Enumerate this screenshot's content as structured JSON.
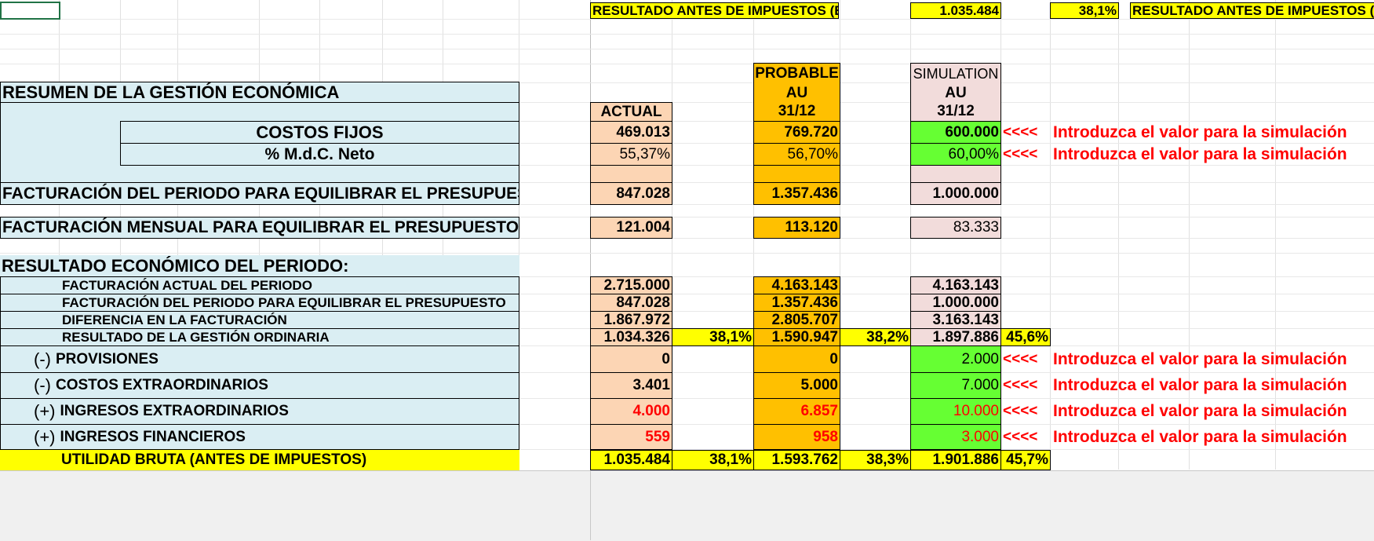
{
  "top": {
    "ebt_label": "RESULTADO ANTES DE IMPUESTOS (EBT)",
    "ebt_value": "1.035.484",
    "ebt_pct": "38,1%",
    "ebt_label2": "RESULTADO ANTES DE IMPUESTOS (EBT)"
  },
  "headers": {
    "probable": [
      "PROBABLE",
      "AU",
      "31/12"
    ],
    "simulation": [
      "SIMULATION",
      "AU",
      "31/12"
    ],
    "actual": "ACTUAL"
  },
  "summary": {
    "title": "RESUMEN DE LA GESTIÓN ECONÓMICA",
    "costos_fijos_label": "COSTOS FIJOS",
    "mdc_label": "% M.d.C. Neto",
    "fact_periodo_label": "FACTURACIÓN DEL PERIODO PARA EQUILIBRAR EL PRESUPUESTO",
    "fact_mensual_label": "FACTURACIÓN MENSUAL PARA EQUILIBRAR EL PRESUPUESTO"
  },
  "values": {
    "costos_fijos": [
      "469.013",
      "769.720",
      "600.000"
    ],
    "mdc": [
      "55,37%",
      "56,70%",
      "60,00%"
    ],
    "fact_periodo": [
      "847.028",
      "1.357.436",
      "1.000.000"
    ],
    "fact_mensual": [
      "121.004",
      "113.120",
      "83.333"
    ]
  },
  "hint": {
    "arrows": "<<<<",
    "text": "Introduzca el valor para la simulación"
  },
  "results": {
    "title": "RESULTADO ECONÓMICO DEL PERIODO:",
    "rows": [
      {
        "label": "FACTURACIÓN ACTUAL DEL PERIODO",
        "actual": "2.715.000",
        "probable": "4.163.143",
        "simulation": "4.163.143"
      },
      {
        "label": "FACTURACIÓN DEL PERIODO PARA EQUILIBRAR EL PRESUPUESTO",
        "actual": "847.028",
        "probable": "1.357.436",
        "simulation": "1.000.000"
      },
      {
        "label": "DIFERENCIA EN LA FACTURACIÓN",
        "actual": "1.867.972",
        "probable": "2.805.707",
        "simulation": "3.163.143"
      },
      {
        "label": "RESULTADO DE LA GESTIÓN ORDINARIA",
        "actual": "1.034.326",
        "actual_pct": "38,1%",
        "probable": "1.590.947",
        "probable_pct": "38,2%",
        "simulation": "1.897.886",
        "simulation_pct": "45,6%"
      }
    ],
    "adjustments": [
      {
        "sign": "(-)",
        "label": "PROVISIONES",
        "actual": "0",
        "probable": "0",
        "simulation": "2.000"
      },
      {
        "sign": "(-)",
        "label": "COSTOS EXTRAORDINARIOS",
        "actual": "3.401",
        "probable": "5.000",
        "simulation": "7.000"
      },
      {
        "sign": "(+)",
        "label": "INGRESOS EXTRAORDINARIOS",
        "actual": "4.000",
        "probable": "6.857",
        "simulation": "10.000"
      },
      {
        "sign": "(+)",
        "label": "INGRESOS FINANCIEROS",
        "actual": "559",
        "probable": "958",
        "simulation": "3.000"
      }
    ],
    "total": {
      "label": "UTILIDAD BRUTA (ANTES DE IMPUESTOS)",
      "actual": "1.035.484",
      "actual_pct": "38,1%",
      "probable": "1.593.762",
      "probable_pct": "38,3%",
      "simulation": "1.901.886",
      "simulation_pct": "45,7%"
    }
  }
}
